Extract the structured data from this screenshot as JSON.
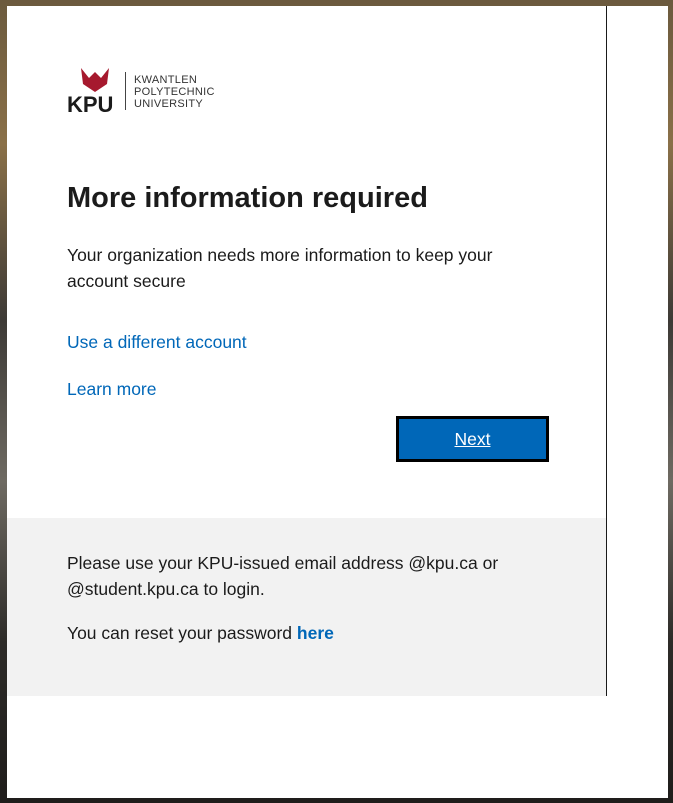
{
  "logo": {
    "abbr": "KPU",
    "line1": "KWANTLEN",
    "line2": "POLYTECHNIC",
    "line3": "UNIVERSITY",
    "brand_color": "#a6192e"
  },
  "dialog": {
    "title": "More information required",
    "description": "Your organization needs more information to keep your account secure",
    "use_different_account": "Use a different account",
    "learn_more": "Learn more",
    "next_label": "Next"
  },
  "footer": {
    "message": "Please use your KPU-issued email address @kpu.ca or @student.kpu.ca to login.",
    "reset_prefix": "You can reset your password",
    "reset_link": "here"
  },
  "colors": {
    "accent": "#0067b8",
    "footer_bg": "#f2f2f2"
  }
}
